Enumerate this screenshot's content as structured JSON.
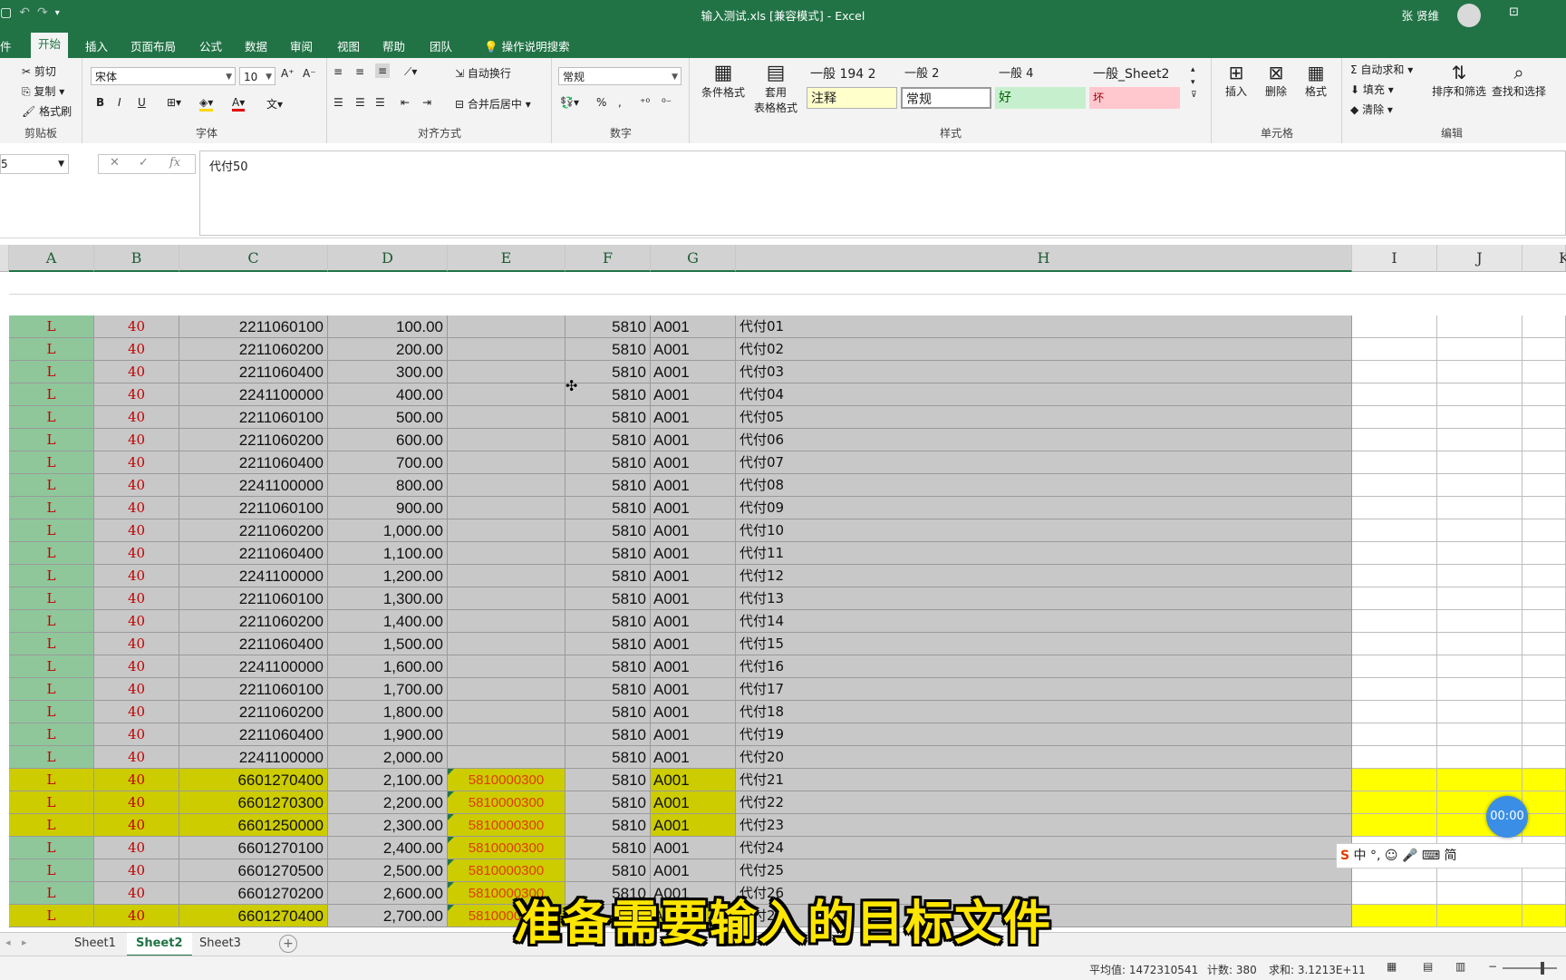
{
  "window": {
    "title": "输入测试.xls  [兼容模式]  -  Excel",
    "user": "张 贤维",
    "qa_icons": [
      "save-icon",
      "undo-icon",
      "redo-icon",
      "customize-icon"
    ]
  },
  "tabs": [
    "件",
    "开始",
    "插入",
    "页面布局",
    "公式",
    "数据",
    "审阅",
    "视图",
    "帮助",
    "团队",
    "操作说明搜索"
  ],
  "active_tab": "开始",
  "ribbon": {
    "clipboard": {
      "cut": "剪切",
      "copy": "复制",
      "painter": "格式刷",
      "label": "剪贴板"
    },
    "font": {
      "name": "宋体",
      "size": "10",
      "bold": "B",
      "italic": "I",
      "underline": "U",
      "label": "字体"
    },
    "align": {
      "wrap": "自动换行",
      "merge": "合并后居中",
      "label": "对齐方式"
    },
    "number": {
      "format": "常规",
      "percent": "%",
      "comma": ",",
      "label": "数字"
    },
    "styles": {
      "cond": "条件格式",
      "table": "套用\n表格格式",
      "cells": [
        "一般 194 2",
        "一般 2",
        "一般 4",
        "一般_Sheet2",
        "注释",
        "常规",
        "好",
        "坏"
      ],
      "label": "样式"
    },
    "cells": {
      "insert": "插入",
      "delete": "删除",
      "format": "格式",
      "label": "单元格"
    },
    "edit": {
      "autosum": "自动求和",
      "fill": "填充",
      "clear": "清除",
      "sort": "排序和筛选",
      "find": "查找和选择",
      "label": "编辑"
    }
  },
  "formula_bar": {
    "name_box": "5",
    "fx": "fx",
    "formula": "代付50"
  },
  "columns": [
    "A",
    "B",
    "C",
    "D",
    "E",
    "F",
    "G",
    "H",
    "I",
    "J",
    "K"
  ],
  "rows": [
    {
      "a": "L",
      "b": "40",
      "c": "2211060100",
      "d": "100.00",
      "e": "",
      "f": "5810",
      "g": "A001",
      "h": "代付01",
      "y": false
    },
    {
      "a": "L",
      "b": "40",
      "c": "2211060200",
      "d": "200.00",
      "e": "",
      "f": "5810",
      "g": "A001",
      "h": "代付02",
      "y": false
    },
    {
      "a": "L",
      "b": "40",
      "c": "2211060400",
      "d": "300.00",
      "e": "",
      "f": "5810",
      "g": "A001",
      "h": "代付03",
      "y": false
    },
    {
      "a": "L",
      "b": "40",
      "c": "2241100000",
      "d": "400.00",
      "e": "",
      "f": "5810",
      "g": "A001",
      "h": "代付04",
      "y": false
    },
    {
      "a": "L",
      "b": "40",
      "c": "2211060100",
      "d": "500.00",
      "e": "",
      "f": "5810",
      "g": "A001",
      "h": "代付05",
      "y": false
    },
    {
      "a": "L",
      "b": "40",
      "c": "2211060200",
      "d": "600.00",
      "e": "",
      "f": "5810",
      "g": "A001",
      "h": "代付06",
      "y": false
    },
    {
      "a": "L",
      "b": "40",
      "c": "2211060400",
      "d": "700.00",
      "e": "",
      "f": "5810",
      "g": "A001",
      "h": "代付07",
      "y": false
    },
    {
      "a": "L",
      "b": "40",
      "c": "2241100000",
      "d": "800.00",
      "e": "",
      "f": "5810",
      "g": "A001",
      "h": "代付08",
      "y": false
    },
    {
      "a": "L",
      "b": "40",
      "c": "2211060100",
      "d": "900.00",
      "e": "",
      "f": "5810",
      "g": "A001",
      "h": "代付09",
      "y": false
    },
    {
      "a": "L",
      "b": "40",
      "c": "2211060200",
      "d": "1,000.00",
      "e": "",
      "f": "5810",
      "g": "A001",
      "h": "代付10",
      "y": false
    },
    {
      "a": "L",
      "b": "40",
      "c": "2211060400",
      "d": "1,100.00",
      "e": "",
      "f": "5810",
      "g": "A001",
      "h": "代付11",
      "y": false
    },
    {
      "a": "L",
      "b": "40",
      "c": "2241100000",
      "d": "1,200.00",
      "e": "",
      "f": "5810",
      "g": "A001",
      "h": "代付12",
      "y": false
    },
    {
      "a": "L",
      "b": "40",
      "c": "2211060100",
      "d": "1,300.00",
      "e": "",
      "f": "5810",
      "g": "A001",
      "h": "代付13",
      "y": false
    },
    {
      "a": "L",
      "b": "40",
      "c": "2211060200",
      "d": "1,400.00",
      "e": "",
      "f": "5810",
      "g": "A001",
      "h": "代付14",
      "y": false
    },
    {
      "a": "L",
      "b": "40",
      "c": "2211060400",
      "d": "1,500.00",
      "e": "",
      "f": "5810",
      "g": "A001",
      "h": "代付15",
      "y": false
    },
    {
      "a": "L",
      "b": "40",
      "c": "2241100000",
      "d": "1,600.00",
      "e": "",
      "f": "5810",
      "g": "A001",
      "h": "代付16",
      "y": false
    },
    {
      "a": "L",
      "b": "40",
      "c": "2211060100",
      "d": "1,700.00",
      "e": "",
      "f": "5810",
      "g": "A001",
      "h": "代付17",
      "y": false
    },
    {
      "a": "L",
      "b": "40",
      "c": "2211060200",
      "d": "1,800.00",
      "e": "",
      "f": "5810",
      "g": "A001",
      "h": "代付18",
      "y": false
    },
    {
      "a": "L",
      "b": "40",
      "c": "2211060400",
      "d": "1,900.00",
      "e": "",
      "f": "5810",
      "g": "A001",
      "h": "代付19",
      "y": false
    },
    {
      "a": "L",
      "b": "40",
      "c": "2241100000",
      "d": "2,000.00",
      "e": "",
      "f": "5810",
      "g": "A001",
      "h": "代付20",
      "y": false
    },
    {
      "a": "L",
      "b": "40",
      "c": "6601270400",
      "d": "2,100.00",
      "e": "5810000300",
      "f": "5810",
      "g": "A001",
      "h": "代付21",
      "y": true
    },
    {
      "a": "L",
      "b": "40",
      "c": "6601270300",
      "d": "2,200.00",
      "e": "5810000300",
      "f": "5810",
      "g": "A001",
      "h": "代付22",
      "y": true
    },
    {
      "a": "L",
      "b": "40",
      "c": "6601250000",
      "d": "2,300.00",
      "e": "5810000300",
      "f": "5810",
      "g": "A001",
      "h": "代付23",
      "y": true
    },
    {
      "a": "L",
      "b": "40",
      "c": "6601270100",
      "d": "2,400.00",
      "e": "5810000300",
      "f": "5810",
      "g": "A001",
      "h": "代付24",
      "y": false
    },
    {
      "a": "L",
      "b": "40",
      "c": "6601270500",
      "d": "2,500.00",
      "e": "5810000300",
      "f": "5810",
      "g": "A001",
      "h": "代付25",
      "y": false
    },
    {
      "a": "L",
      "b": "40",
      "c": "6601270200",
      "d": "2,600.00",
      "e": "5810000300",
      "f": "5810",
      "g": "A001",
      "h": "代付26",
      "y": false
    },
    {
      "a": "L",
      "b": "40",
      "c": "6601270400",
      "d": "2,700.00",
      "e": "5810000300",
      "f": "5810",
      "g": "A001",
      "h": "代付27",
      "y": true
    }
  ],
  "sheets": [
    "Sheet1",
    "Sheet2",
    "Sheet3"
  ],
  "active_sheet": "Sheet2",
  "status": {
    "average": "平均值: 1472310541",
    "count": "计数: 380",
    "sum": "求和: 3.1213E+11"
  },
  "overlay": {
    "subtitle": "准备需要输入的目标文件",
    "timer": "00:00",
    "ime": "中 °, ☺ 🎤 ⌨ 简"
  },
  "colors": {
    "excel_green": "#217346",
    "row_gray": "#c8c8c8",
    "col_a_green": "#8fc79b",
    "yellow": "#cccc00",
    "bright_yellow": "#ffff00",
    "red_text": "#c00000"
  }
}
